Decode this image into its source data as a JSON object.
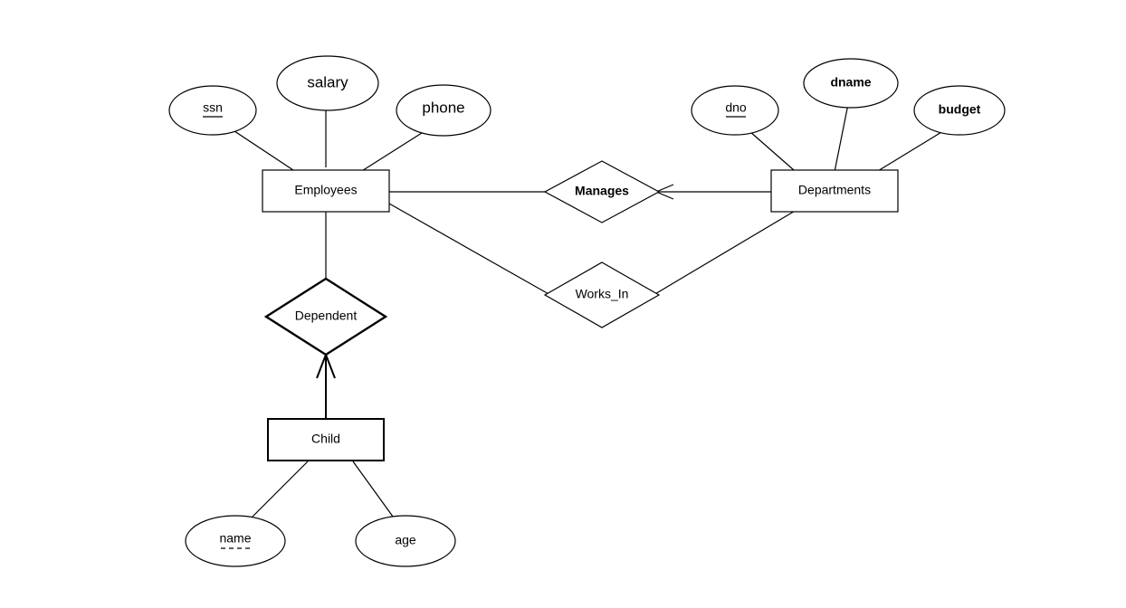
{
  "entities": {
    "employees": "Employees",
    "departments": "Departments",
    "child": "Child"
  },
  "relationships": {
    "manages": "Manages",
    "works_in": "Works_In",
    "dependent": "Dependent"
  },
  "attributes": {
    "ssn": "ssn",
    "salary": "salary",
    "phone": "phone",
    "dno": "dno",
    "dname": "dname",
    "budget": "budget",
    "name": "name",
    "age": "age"
  }
}
